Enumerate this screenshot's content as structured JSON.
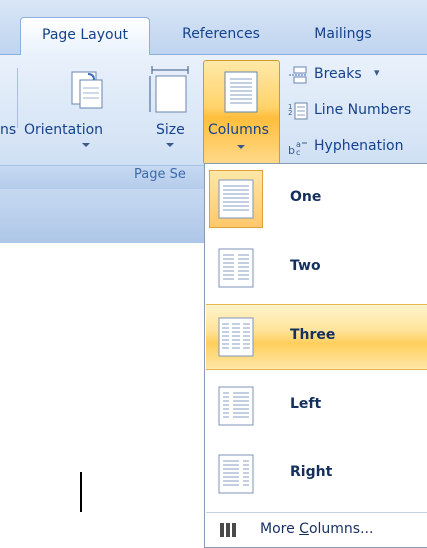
{
  "tabs": [
    {
      "label": "Page Layout",
      "active": true
    },
    {
      "label": "References",
      "active": false
    },
    {
      "label": "Mailings",
      "active": false
    }
  ],
  "ribbon": {
    "partial_label": "ns",
    "orientation_label": "Orientation",
    "size_label": "Size",
    "columns_label": "Columns",
    "breaks_label": "Breaks",
    "line_numbers_label": "Line Numbers",
    "hyphenation_label": "Hyphenation",
    "group_label": "Page Se"
  },
  "columns_menu": {
    "items": [
      {
        "label": "One",
        "selected": true
      },
      {
        "label": "Two",
        "selected": false
      },
      {
        "label": "Three",
        "selected": false,
        "hovered": true
      },
      {
        "label": "Left",
        "selected": false
      },
      {
        "label": "Right",
        "selected": false
      }
    ],
    "more_prefix": "More ",
    "more_accel": "C",
    "more_suffix": "olumns..."
  },
  "colors": {
    "ribbon_blue": "#d7e5f6",
    "highlight_orange": "#ffcf5c",
    "text_blue": "#15428b"
  }
}
